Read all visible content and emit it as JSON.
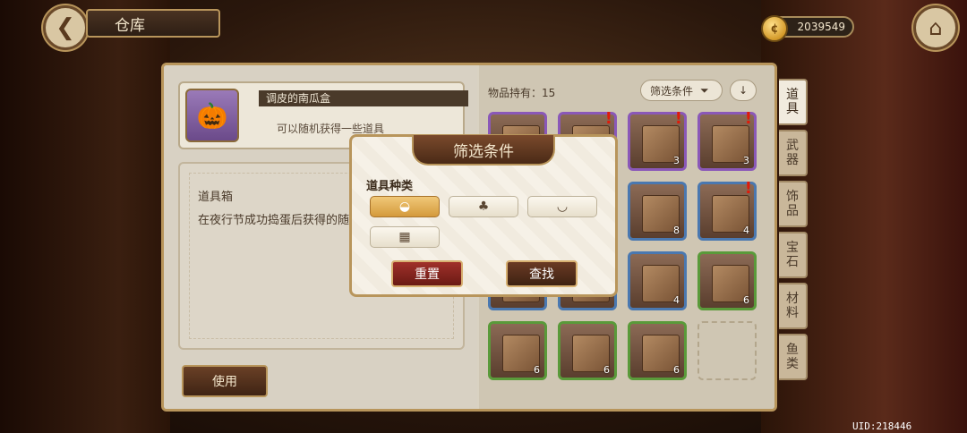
{
  "header": {
    "back_icon": "back-arrow-icon",
    "title": "仓库",
    "coins": "2039549",
    "coin_icon_glyph": "¢",
    "home_icon": "home-icon"
  },
  "item_detail": {
    "name": "调皮的南瓜盒",
    "brief": "可以随机获得一些道具",
    "category": "道具箱",
    "description": "在夜行节成功捣蛋后获得的随机获得各类惊喜。",
    "use_label": "使用"
  },
  "inventory": {
    "count_label": "物品持有：15",
    "filter_label": "筛选条件",
    "filter_icon": "funnel-icon",
    "sort_icon": "arrow-down-icon",
    "slots": [
      {
        "rarity": "purple",
        "qty": "",
        "alert": "",
        "icon": "pumpkin-box-icon"
      },
      {
        "rarity": "purple",
        "qty": "",
        "alert": "!",
        "icon": "gift-box-icon"
      },
      {
        "rarity": "purple",
        "qty": "3",
        "alert": "!",
        "icon": "gift-box-icon"
      },
      {
        "rarity": "purple",
        "qty": "3",
        "alert": "!",
        "icon": "gift-box-icon"
      },
      {
        "rarity": "blue",
        "qty": "",
        "alert": "",
        "icon": "gift-box-icon"
      },
      {
        "rarity": "blue",
        "qty": "",
        "alert": "",
        "icon": "gift-box-icon"
      },
      {
        "rarity": "blue",
        "qty": "8",
        "alert": "",
        "icon": "treasure-chest-icon"
      },
      {
        "rarity": "blue",
        "qty": "4",
        "alert": "!",
        "icon": "gift-box-icon"
      },
      {
        "rarity": "blue",
        "qty": "",
        "alert": "",
        "icon": "gift-box-icon"
      },
      {
        "rarity": "blue",
        "qty": "",
        "alert": "",
        "icon": "gift-box-icon"
      },
      {
        "rarity": "blue",
        "qty": "4",
        "alert": "",
        "icon": "gift-box-icon"
      },
      {
        "rarity": "green",
        "qty": "6",
        "alert": "",
        "icon": "gift-box-icon"
      },
      {
        "rarity": "green",
        "qty": "6",
        "alert": "",
        "icon": "gift-box-icon"
      },
      {
        "rarity": "green",
        "qty": "6",
        "alert": "",
        "icon": "gift-box-icon"
      },
      {
        "rarity": "green",
        "qty": "6",
        "alert": "",
        "icon": "gift-box-icon"
      }
    ]
  },
  "tabs": [
    "道\n具",
    "武\n器",
    "饰\n品",
    "宝\n石",
    "材\n料",
    "鱼\n类"
  ],
  "filter_modal": {
    "title": "筛选条件",
    "section_label": "道具种类",
    "chips": [
      {
        "icon": "item-box-icon",
        "glyph": "◒",
        "active": true
      },
      {
        "icon": "mushroom-icon",
        "glyph": "♣",
        "active": false
      },
      {
        "icon": "bowl-icon",
        "glyph": "◡",
        "active": false
      },
      {
        "icon": "furniture-icon",
        "glyph": "▦",
        "active": false
      }
    ],
    "reset_label": "重置",
    "search_label": "查找"
  },
  "uid": "UID:218446",
  "colors": {
    "accent_gold": "#b8955b",
    "rare_purple": "#8a58b8",
    "rare_blue": "#4a78b0",
    "rare_green": "#5a9a3a",
    "reset_red": "#a0302a"
  }
}
